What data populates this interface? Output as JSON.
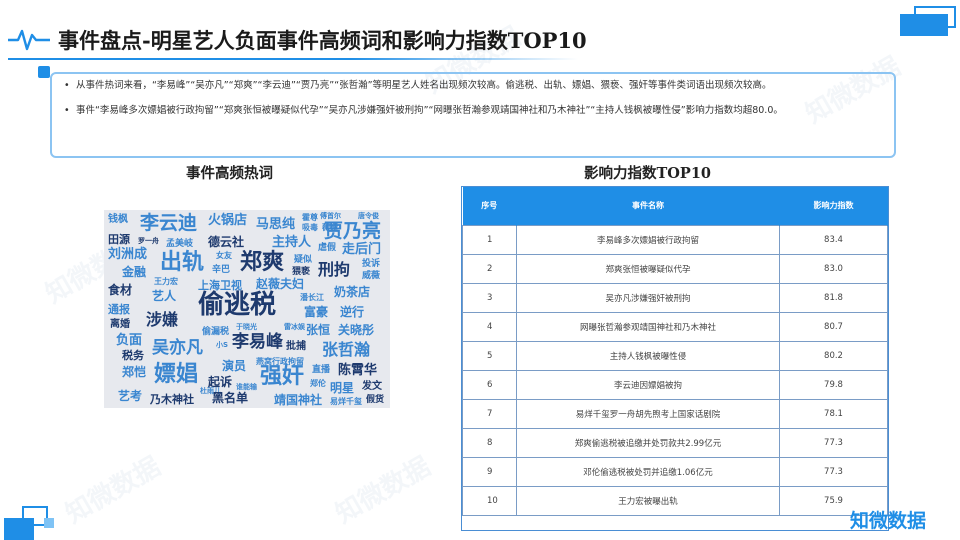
{
  "header": {
    "title": "事件盘点-明星艺人负面事件高频词和影响力指数TOP10"
  },
  "notes": [
    "从事件热词来看，“李易峰”“吴亦凡”“郑爽”“李云迪”“贾乃亮”“张哲瀚”等明星艺人姓名出现频次较高。偷逃税、出轨、嫖娼、猥亵、强奸等事件类词语出现频次较高。",
    "事件“李易峰多次嫖娼被行政拘留”“郑爽张恒被曝疑似代孕”“吴亦凡涉嫌强奸被刑拘”“网曝张哲瀚参观靖国神社和乃木神社”“主持人钱枫被曝性侵”影响力指数均超80.0。"
  ],
  "wordcloud": {
    "title": "事件高频热词",
    "words": [
      {
        "t": "钱枫",
        "c": "#3a86d0"
      },
      {
        "t": "李云迪",
        "c": "#3a86d0"
      },
      {
        "t": "火锅店",
        "c": "#3a86d0"
      },
      {
        "t": "马思纯",
        "c": "#3a86d0"
      },
      {
        "t": "霍尊",
        "c": "#3a86d0"
      },
      {
        "t": "吸毒",
        "c": "#3a86d0"
      },
      {
        "t": "傅首尔",
        "c": "#3a86d0"
      },
      {
        "t": "薇娅",
        "c": "#3a86d0"
      },
      {
        "t": "唐令俊",
        "c": "#3a86d0"
      },
      {
        "t": "贾乃亮",
        "c": "#3a86d0"
      },
      {
        "t": "田源",
        "c": "#1e3a6e"
      },
      {
        "t": "德云社",
        "c": "#1e3a6e"
      },
      {
        "t": "主持人",
        "c": "#3a86d0"
      },
      {
        "t": "虐假",
        "c": "#3a86d0"
      },
      {
        "t": "罗一舟",
        "c": "#1e3a6e"
      },
      {
        "t": "孟美岐",
        "c": "#3a86d0"
      },
      {
        "t": "走后门",
        "c": "#3a86d0"
      },
      {
        "t": "刘洲成",
        "c": "#3a86d0"
      },
      {
        "t": "出轨",
        "c": "#3a86d0"
      },
      {
        "t": "郑爽",
        "c": "#1e3a6e"
      },
      {
        "t": "女友",
        "c": "#3a86d0"
      },
      {
        "t": "疑似",
        "c": "#3a86d0"
      },
      {
        "t": "金融",
        "c": "#3a86d0"
      },
      {
        "t": "辛巴",
        "c": "#3a86d0"
      },
      {
        "t": "猥亵",
        "c": "#1e3a6e"
      },
      {
        "t": "刑拘",
        "c": "#1e3a6e"
      },
      {
        "t": "投诉",
        "c": "#3a86d0"
      },
      {
        "t": "王力宏",
        "c": "#3a86d0"
      },
      {
        "t": "威薇",
        "c": "#3a86d0"
      },
      {
        "t": "食材",
        "c": "#1e3a6e"
      },
      {
        "t": "上海卫视",
        "c": "#3a86d0"
      },
      {
        "t": "赵薇夫妇",
        "c": "#3a86d0"
      },
      {
        "t": "奶茶店",
        "c": "#3a86d0"
      },
      {
        "t": "艺人",
        "c": "#3a86d0"
      },
      {
        "t": "偷逃税",
        "c": "#1e3a6e"
      },
      {
        "t": "潘长江",
        "c": "#3a86d0"
      },
      {
        "t": "通报",
        "c": "#3a86d0"
      },
      {
        "t": "富豪",
        "c": "#3a86d0"
      },
      {
        "t": "逆行",
        "c": "#3a86d0"
      },
      {
        "t": "涉嫌",
        "c": "#1e3a6e"
      },
      {
        "t": "离婚",
        "c": "#1e3a6e"
      },
      {
        "t": "于晓光",
        "c": "#3a86d0"
      },
      {
        "t": "雷冰娱",
        "c": "#3a86d0"
      },
      {
        "t": "张恒",
        "c": "#3a86d0"
      },
      {
        "t": "关晓彤",
        "c": "#3a86d0"
      },
      {
        "t": "偷漏税",
        "c": "#3a86d0"
      },
      {
        "t": "负面",
        "c": "#3a86d0"
      },
      {
        "t": "李易峰",
        "c": "#1e3a6e"
      },
      {
        "t": "小S",
        "c": "#3a86d0"
      },
      {
        "t": "吴亦凡",
        "c": "#3a86d0"
      },
      {
        "t": "批捕",
        "c": "#1e3a6e"
      },
      {
        "t": "张哲瀚",
        "c": "#3a86d0"
      },
      {
        "t": "税务",
        "c": "#1e3a6e"
      },
      {
        "t": "演员",
        "c": "#3a86d0"
      },
      {
        "t": "燕窝行政拘留",
        "c": "#3a86d0"
      },
      {
        "t": "郑恺",
        "c": "#3a86d0"
      },
      {
        "t": "嫖娼",
        "c": "#3a86d0"
      },
      {
        "t": "强奸",
        "c": "#3a86d0"
      },
      {
        "t": "直播",
        "c": "#3a86d0"
      },
      {
        "t": "陈霄华",
        "c": "#1e3a6e"
      },
      {
        "t": "起诉",
        "c": "#1e3a6e"
      },
      {
        "t": "谁能输",
        "c": "#3a86d0"
      },
      {
        "t": "杜雨儿",
        "c": "#3a86d0"
      },
      {
        "t": "郑伦",
        "c": "#3a86d0"
      },
      {
        "t": "明星",
        "c": "#3a86d0"
      },
      {
        "t": "发文",
        "c": "#1e3a6e"
      },
      {
        "t": "艺考",
        "c": "#3a86d0"
      },
      {
        "t": "乃木神社",
        "c": "#1e3a6e"
      },
      {
        "t": "黑名单",
        "c": "#1e3a6e"
      },
      {
        "t": "靖国神社",
        "c": "#3a86d0"
      },
      {
        "t": "易烊千玺",
        "c": "#3a86d0"
      },
      {
        "t": "假货",
        "c": "#1e3a6e"
      }
    ]
  },
  "table": {
    "title": "影响力指数TOP10",
    "headers": [
      "序号",
      "事件名称",
      "影响力指数"
    ],
    "rows": [
      {
        "no": "1",
        "name": "李易峰多次嫖娼被行政拘留",
        "value": "83.4"
      },
      {
        "no": "2",
        "name": "郑爽张恒被曝疑似代孕",
        "value": "83.0"
      },
      {
        "no": "3",
        "name": "吴亦凡涉嫌强奸被刑拘",
        "value": "81.8"
      },
      {
        "no": "4",
        "name": "网曝张哲瀚参观靖国神社和乃木神社",
        "value": "80.7"
      },
      {
        "no": "5",
        "name": "主持人钱枫被曝性侵",
        "value": "80.2"
      },
      {
        "no": "6",
        "name": "李云迪因嫖娼被拘",
        "value": "79.8"
      },
      {
        "no": "7",
        "name": "易烊千玺罗一舟胡先煦考上国家话剧院",
        "value": "78.1"
      },
      {
        "no": "8",
        "name": "郑爽偷逃税被追缴并处罚款共2.99亿元",
        "value": "77.3"
      },
      {
        "no": "9",
        "name": "邓伦偷逃税被处罚并追缴1.06亿元",
        "value": "77.3"
      },
      {
        "no": "10",
        "name": "王力宏被曝出轨",
        "value": "75.9"
      }
    ]
  },
  "watermark": "知微数据",
  "logo": "知微数据"
}
